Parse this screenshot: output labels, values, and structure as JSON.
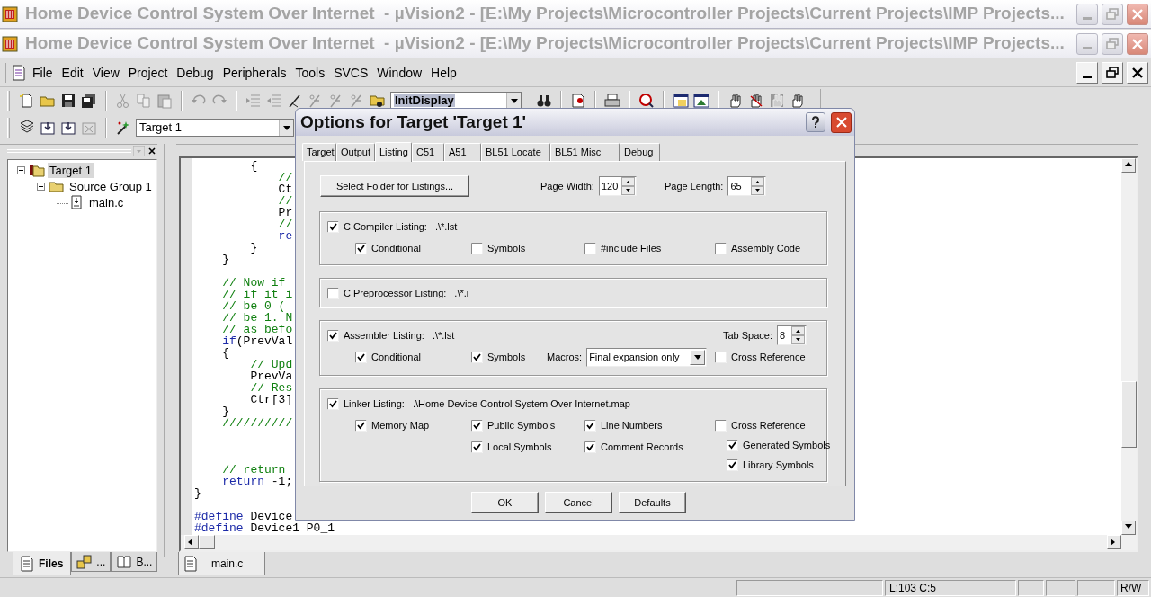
{
  "window_titles": [
    {
      "title": "Home Device Control System Over Internet  - µVision2 - [E:\\My Projects\\Microcontroller Projects\\Current Projects\\IMP Projects..."
    },
    {
      "title": "Home Device Control System Over Internet  - µVision2 - [E:\\My Projects\\Microcontroller Projects\\Current Projects\\IMP Projects..."
    }
  ],
  "menu": [
    "File",
    "Edit",
    "View",
    "Project",
    "Debug",
    "Peripherals",
    "Tools",
    "SVCS",
    "Window",
    "Help"
  ],
  "toolbar": {
    "function_combo": "InitDisplay",
    "target_combo": "Target 1"
  },
  "project_panel": {
    "tree": [
      {
        "label": "Target 1",
        "kind": "target",
        "expanded": true,
        "selected": true,
        "children": [
          {
            "label": "Source Group 1",
            "kind": "group",
            "expanded": true,
            "selected": false,
            "children": [
              {
                "label": "main.c",
                "kind": "file",
                "selected": false
              }
            ]
          }
        ]
      }
    ],
    "tabs": [
      {
        "label": "Files",
        "selected": true
      },
      {
        "label": "...",
        "selected": false
      },
      {
        "label": "B...",
        "selected": false
      }
    ]
  },
  "editor": {
    "lines": [
      {
        "kind": "code",
        "segments": [
          {
            "kind": "plain",
            "text": "        {"
          }
        ]
      },
      {
        "kind": "code",
        "segments": [
          {
            "kind": "comment",
            "text": "            //"
          }
        ]
      },
      {
        "kind": "code",
        "segments": [
          {
            "kind": "plain",
            "text": "            Ct"
          }
        ]
      },
      {
        "kind": "code",
        "segments": [
          {
            "kind": "comment",
            "text": "            //"
          }
        ]
      },
      {
        "kind": "code",
        "segments": [
          {
            "kind": "plain",
            "text": "            Pr"
          }
        ]
      },
      {
        "kind": "code",
        "segments": [
          {
            "kind": "comment",
            "text": "            //"
          }
        ]
      },
      {
        "kind": "code",
        "segments": [
          {
            "kind": "keyword",
            "text": "            re"
          }
        ]
      },
      {
        "kind": "code",
        "segments": [
          {
            "kind": "plain",
            "text": "        }"
          }
        ]
      },
      {
        "kind": "code",
        "segments": [
          {
            "kind": "plain",
            "text": "    }"
          }
        ]
      },
      {
        "kind": "blank"
      },
      {
        "kind": "code",
        "segments": [
          {
            "kind": "comment",
            "text": "    // Now if"
          }
        ]
      },
      {
        "kind": "code",
        "segments": [
          {
            "kind": "comment",
            "text": "    // if it i"
          }
        ]
      },
      {
        "kind": "code",
        "segments": [
          {
            "kind": "comment",
            "text": "    // be 0 ("
          }
        ]
      },
      {
        "kind": "code",
        "segments": [
          {
            "kind": "comment",
            "text": "    // be 1. N"
          }
        ]
      },
      {
        "kind": "code",
        "segments": [
          {
            "kind": "comment",
            "text": "    // as befo"
          }
        ]
      },
      {
        "kind": "code",
        "segments": [
          {
            "kind": "keyword",
            "text": "    if"
          },
          {
            "kind": "plain",
            "text": "(PrevVal"
          }
        ]
      },
      {
        "kind": "code",
        "segments": [
          {
            "kind": "plain",
            "text": "    {"
          }
        ]
      },
      {
        "kind": "code",
        "segments": [
          {
            "kind": "comment",
            "text": "        // Upd"
          }
        ]
      },
      {
        "kind": "code",
        "segments": [
          {
            "kind": "plain",
            "text": "        PrevVa"
          }
        ]
      },
      {
        "kind": "code",
        "segments": [
          {
            "kind": "comment",
            "text": "        // Res"
          }
        ]
      },
      {
        "kind": "code",
        "segments": [
          {
            "kind": "plain",
            "text": "        Ctr[3]"
          }
        ]
      },
      {
        "kind": "code",
        "segments": [
          {
            "kind": "plain",
            "text": "    }"
          }
        ]
      },
      {
        "kind": "code",
        "segments": [
          {
            "kind": "comment",
            "text": "    //////////"
          }
        ]
      },
      {
        "kind": "blank"
      },
      {
        "kind": "blank"
      },
      {
        "kind": "blank"
      },
      {
        "kind": "code",
        "segments": [
          {
            "kind": "comment",
            "text": "    // return"
          }
        ]
      },
      {
        "kind": "code",
        "segments": [
          {
            "kind": "keyword",
            "text": "    return"
          },
          {
            "kind": "plain",
            "text": " -1;"
          }
        ]
      },
      {
        "kind": "code",
        "segments": [
          {
            "kind": "plain",
            "text": "}"
          }
        ]
      },
      {
        "kind": "blank"
      },
      {
        "kind": "code",
        "segments": [
          {
            "kind": "keyword",
            "text": "#define"
          },
          {
            "kind": "plain",
            "text": " Device"
          }
        ]
      },
      {
        "kind": "code",
        "segments": [
          {
            "kind": "keyword",
            "text": "#define"
          },
          {
            "kind": "plain",
            "text": " Device1 P0_1"
          }
        ]
      }
    ],
    "tabs": [
      {
        "label": "main.c",
        "selected": true
      }
    ]
  },
  "status_bar": {
    "position": "L:103 C:5",
    "mode": "R/W"
  },
  "dialog": {
    "title": "Options for Target 'Target 1'",
    "tabs": [
      {
        "label": "Target",
        "selected": false
      },
      {
        "label": "Output",
        "selected": false
      },
      {
        "label": "Listing",
        "selected": true
      },
      {
        "label": "C51",
        "selected": false
      },
      {
        "label": "A51",
        "selected": false
      },
      {
        "label": "BL51 Locate",
        "selected": false
      },
      {
        "label": "BL51 Misc",
        "selected": false
      },
      {
        "label": "Debug",
        "selected": false
      }
    ],
    "select_folder_button": "Select Folder for Listings...",
    "page_width": {
      "label": "Page Width:",
      "value": "120"
    },
    "page_length": {
      "label": "Page Length:",
      "value": "65"
    },
    "groups": [
      {
        "label": "C Compiler Listing:",
        "path": ".\\*.lst",
        "checked": true,
        "columns": [
          [
            {
              "kind": "check",
              "label": "Conditional",
              "checked": true
            }
          ],
          [
            {
              "kind": "check",
              "label": "Symbols",
              "checked": false
            }
          ],
          [
            {
              "kind": "check",
              "label": "#include Files",
              "checked": false
            }
          ],
          [
            {
              "kind": "check",
              "label": "Assembly Code",
              "checked": false
            }
          ]
        ]
      },
      {
        "label": "C Preprocessor Listing:",
        "path": ".\\*.i",
        "checked": false
      },
      {
        "label": "Assembler Listing:",
        "path": ".\\*.lst",
        "checked": true,
        "tab_space": {
          "label": "Tab Space:",
          "value": "8"
        },
        "columns": [
          [
            {
              "kind": "check",
              "label": "Conditional",
              "checked": true
            }
          ],
          [
            {
              "kind": "check",
              "label": "Symbols",
              "checked": true
            }
          ],
          [
            {
              "kind": "select",
              "label": "Macros:",
              "value": "Final expansion only"
            }
          ],
          [
            {
              "kind": "check",
              "label": "Cross Reference",
              "checked": false
            }
          ]
        ]
      },
      {
        "label": "Linker Listing:",
        "path": ".\\Home Device Control System Over Internet.map",
        "checked": true,
        "columns": [
          [
            {
              "kind": "check",
              "label": "Memory Map",
              "checked": true
            }
          ],
          [
            {
              "kind": "check",
              "label": "Public Symbols",
              "checked": true
            },
            {
              "kind": "check",
              "label": "Local Symbols",
              "checked": true
            }
          ],
          [
            {
              "kind": "check",
              "label": "Line Numbers",
              "checked": true
            },
            {
              "kind": "check",
              "label": "Comment Records",
              "checked": true
            }
          ],
          [
            {
              "kind": "check",
              "label": "Cross Reference",
              "checked": false
            },
            {
              "kind": "check",
              "label": "Generated Symbols",
              "checked": true
            },
            {
              "kind": "check",
              "label": "Library Symbols",
              "checked": true
            }
          ]
        ]
      }
    ],
    "buttons": [
      "OK",
      "Cancel",
      "Defaults"
    ]
  }
}
